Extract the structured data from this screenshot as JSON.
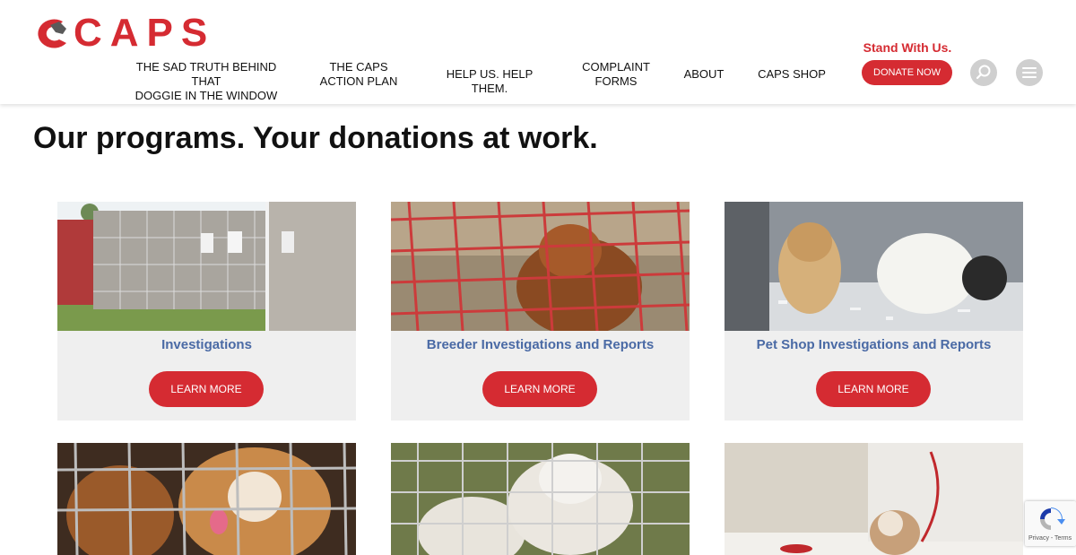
{
  "logo": {
    "text": "CAPS",
    "icon": "dog-head-logo-icon"
  },
  "nav": {
    "items": [
      {
        "line1": "THE SAD TRUTH BEHIND THAT",
        "line2": "DOGGIE IN THE WINDOW"
      },
      {
        "line1": "THE CAPS",
        "line2": "ACTION PLAN"
      },
      {
        "line1": "HELP US. HELP THEM.",
        "line2": ""
      },
      {
        "line1": "COMPLAINT",
        "line2": "FORMS"
      },
      {
        "line1": "ABOUT",
        "line2": ""
      },
      {
        "line1": "CAPS SHOP",
        "line2": ""
      }
    ],
    "stand_with_us": "Stand With Us.",
    "donate_label": "DONATE NOW",
    "search_icon": "search-icon",
    "menu_icon": "hamburger-menu-icon"
  },
  "main": {
    "title": "Our programs. Your donations at work.",
    "cards": [
      {
        "title": "Investigations",
        "button": "LEARN MORE"
      },
      {
        "title": "Breeder Investigations and Reports",
        "button": "LEARN MORE"
      },
      {
        "title": "Pet Shop Investigations and Reports",
        "button": "LEARN MORE"
      }
    ]
  },
  "recaptcha": {
    "links": "Privacy - Terms"
  },
  "colors": {
    "brand_red": "#d52b32",
    "card_title_blue": "#4a6aa5",
    "card_bg": "#efefef"
  }
}
